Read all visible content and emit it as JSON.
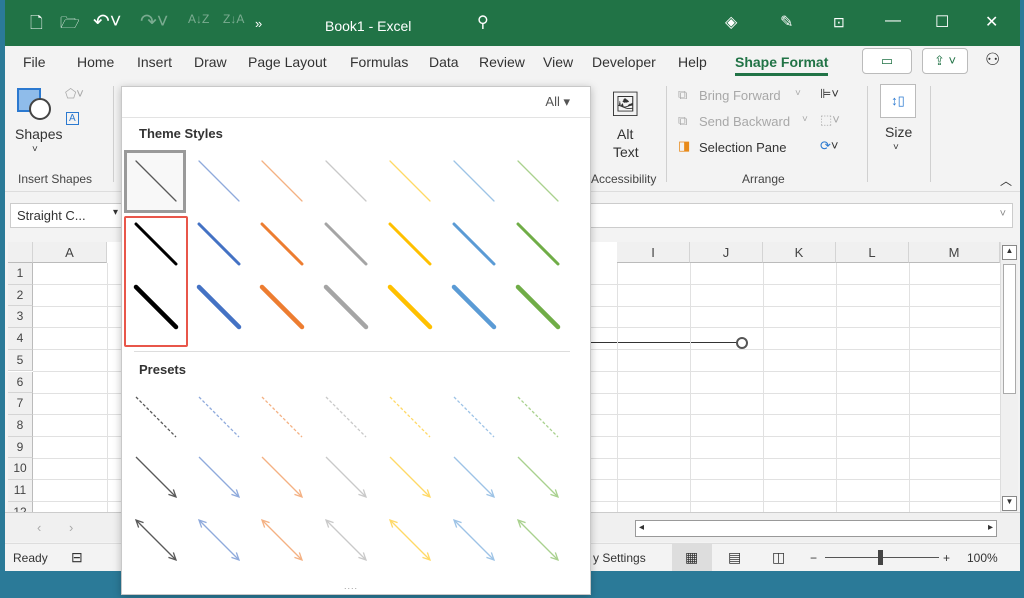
{
  "window": {
    "title": "Book1  -  Excel"
  },
  "quick_access": [
    "new-icon",
    "open-icon",
    "undo-icon",
    "redo-icon",
    "sort-az-icon",
    "sort-za-icon",
    "more-icon"
  ],
  "menu": {
    "tabs": [
      "File",
      "Home",
      "Insert",
      "Draw",
      "Page Layout",
      "Formulas",
      "Data",
      "Review",
      "View",
      "Developer",
      "Help",
      "Shape Format"
    ],
    "active": "Shape Format"
  },
  "ribbon": {
    "shapes_label": "Shapes",
    "insert_shapes_group": "Insert Shapes",
    "alt_text_1": "Alt",
    "alt_text_2": "Text",
    "accessibility_group": "Accessibility",
    "bring_forward": "Bring Forward",
    "send_backward": "Send Backward",
    "selection_pane": "Selection Pane",
    "arrange_group": "Arrange",
    "size_label": "Size"
  },
  "name_box": "Straight C...",
  "columns": [
    "A",
    "I",
    "J",
    "K",
    "L",
    "M"
  ],
  "rows": [
    "1",
    "2",
    "3",
    "4",
    "5",
    "6",
    "7",
    "8",
    "9",
    "10",
    "11",
    "12"
  ],
  "gallery": {
    "filter": "All ▾",
    "theme_heading": "Theme Styles",
    "presets_heading": "Presets",
    "colors": [
      "#404040",
      "#4472c4",
      "#ed7d31",
      "#a5a5a5",
      "#ffc000",
      "#5b9bd5",
      "#70ad47"
    ],
    "light_colors": [
      "#595959",
      "#8faadc",
      "#f4b183",
      "#c9c9c9",
      "#ffd966",
      "#9dc3e6",
      "#a9d18e"
    ],
    "selected_index": 0,
    "highlighted": "black medium and thick lines",
    "more_dots": "...."
  },
  "status": {
    "ready": "Ready",
    "accessibility": "y Settings",
    "zoom": "100%",
    "zoom_level": 100
  },
  "colors": {
    "title_bar": "#217346",
    "accent": "#217346",
    "highlight": "#e8564a"
  }
}
